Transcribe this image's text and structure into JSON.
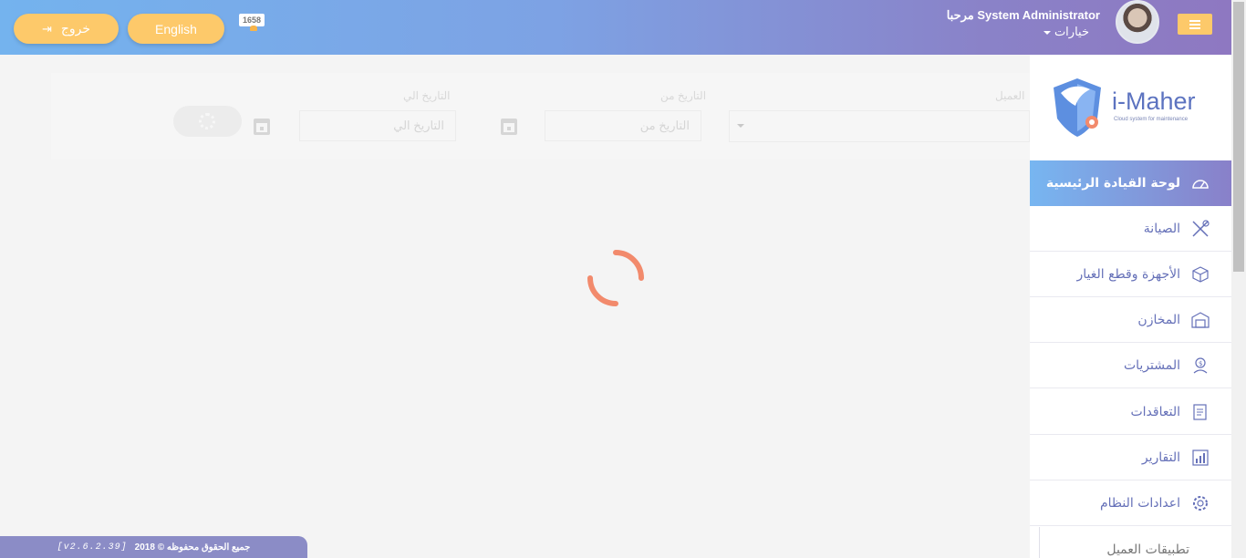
{
  "header": {
    "logout_label": "خروج",
    "language_label": "English",
    "notification_count": "1658",
    "welcome": "مرحبا System Administrator",
    "options_label": "خيارات"
  },
  "filters": {
    "client_label": "العميل",
    "date_from_label": "التاريخ من",
    "date_from_placeholder": "التاريخ من",
    "date_to_label": "التاريخ الي",
    "date_to_placeholder": "التاريخ الي"
  },
  "sidebar": {
    "logo_text": "i-Maher",
    "logo_tagline": "Cloud system for maintenance",
    "items": [
      {
        "label": "لوحة القيادة الرئيسية",
        "icon": "dashboard-icon"
      },
      {
        "label": "الصيانة",
        "icon": "tools-icon"
      },
      {
        "label": "الأجهزة وقطع الغيار",
        "icon": "box-icon"
      },
      {
        "label": "المخازن",
        "icon": "warehouse-icon"
      },
      {
        "label": "المشتريات",
        "icon": "purchase-icon"
      },
      {
        "label": "التعاقدات",
        "icon": "contract-icon"
      },
      {
        "label": "التقارير",
        "icon": "report-icon"
      },
      {
        "label": "اعدادات النظام",
        "icon": "gear-icon"
      },
      {
        "label": "تطبيقات العميل",
        "icon": ""
      }
    ]
  },
  "footer": {
    "copyright": "جميع الحقوق محفوظه © 2018",
    "version": "[v2.6.2.39]"
  },
  "colors": {
    "accent_yellow": "#fdc96a",
    "nav_text": "#6570b8",
    "loader": "#f28a6c"
  }
}
